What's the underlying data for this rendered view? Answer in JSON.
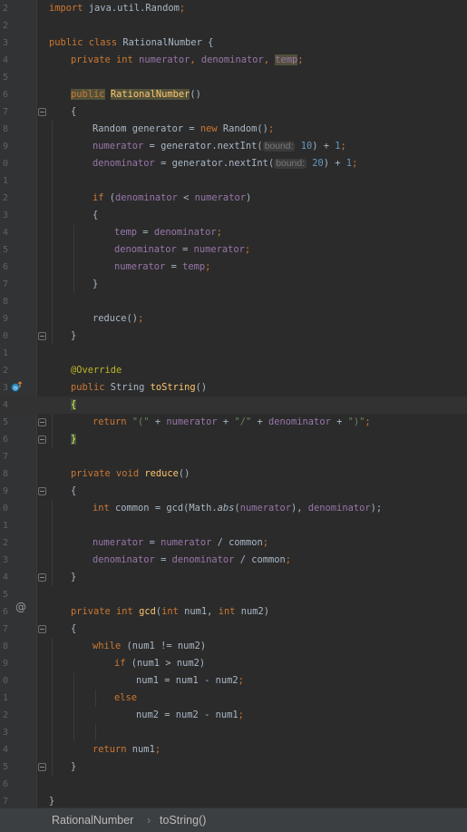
{
  "editor": {
    "lines": [
      {
        "num": "2",
        "indent": 0,
        "tokens": [
          {
            "t": "import ",
            "c": "kw"
          },
          {
            "t": "java.util.Random",
            "c": ""
          },
          {
            "t": ";",
            "c": "kw"
          }
        ]
      },
      {
        "num": "2",
        "indent": 0,
        "tokens": []
      },
      {
        "num": "3",
        "indent": 0,
        "tokens": [
          {
            "t": "public class ",
            "c": "kw"
          },
          {
            "t": "RationalNumber {",
            "c": ""
          }
        ]
      },
      {
        "num": "4",
        "indent": 1,
        "tokens": [
          {
            "t": "private int ",
            "c": "kw"
          },
          {
            "t": "numerator",
            "c": "field"
          },
          {
            "t": ", ",
            "c": "kw"
          },
          {
            "t": "denominator",
            "c": "field"
          },
          {
            "t": ", ",
            "c": "kw"
          },
          {
            "t": "temp",
            "c": "field hl"
          },
          {
            "t": ";",
            "c": "kw"
          }
        ]
      },
      {
        "num": "5",
        "indent": 0,
        "tokens": []
      },
      {
        "num": "6",
        "indent": 1,
        "tokens": [
          {
            "t": "public",
            "c": "kw hl"
          },
          {
            "t": " ",
            "c": ""
          },
          {
            "t": "RationalNumber",
            "c": "method hl"
          },
          {
            "t": "()",
            "c": ""
          }
        ]
      },
      {
        "num": "7",
        "indent": 1,
        "tokens": [
          {
            "t": "{",
            "c": ""
          }
        ]
      },
      {
        "num": "8",
        "indent": 2,
        "tokens": [
          {
            "t": "Random generator = ",
            "c": ""
          },
          {
            "t": "new ",
            "c": "kw"
          },
          {
            "t": "Random()",
            "c": ""
          },
          {
            "t": ";",
            "c": "kw"
          }
        ]
      },
      {
        "num": "9",
        "indent": 2,
        "tokens": [
          {
            "t": "numerator",
            "c": "field"
          },
          {
            "t": " = generator.nextInt(",
            "c": ""
          },
          {
            "t": "bound:",
            "c": "hint"
          },
          {
            "t": " 10",
            "c": "num"
          },
          {
            "t": ") + ",
            "c": ""
          },
          {
            "t": "1",
            "c": "num"
          },
          {
            "t": ";",
            "c": "kw"
          }
        ]
      },
      {
        "num": "0",
        "indent": 2,
        "tokens": [
          {
            "t": "denominator",
            "c": "field"
          },
          {
            "t": " = generator.nextInt(",
            "c": ""
          },
          {
            "t": "bound:",
            "c": "hint"
          },
          {
            "t": " 20",
            "c": "num"
          },
          {
            "t": ") + ",
            "c": ""
          },
          {
            "t": "1",
            "c": "num"
          },
          {
            "t": ";",
            "c": "kw"
          }
        ]
      },
      {
        "num": "1",
        "indent": 0,
        "tokens": []
      },
      {
        "num": "2",
        "indent": 2,
        "tokens": [
          {
            "t": "if ",
            "c": "kw"
          },
          {
            "t": "(",
            "c": ""
          },
          {
            "t": "denominator",
            "c": "field"
          },
          {
            "t": " < ",
            "c": ""
          },
          {
            "t": "numerator",
            "c": "field"
          },
          {
            "t": ")",
            "c": ""
          }
        ]
      },
      {
        "num": "3",
        "indent": 2,
        "tokens": [
          {
            "t": "{",
            "c": ""
          }
        ]
      },
      {
        "num": "4",
        "indent": 3,
        "tokens": [
          {
            "t": "temp",
            "c": "field"
          },
          {
            "t": " = ",
            "c": ""
          },
          {
            "t": "denominator",
            "c": "field"
          },
          {
            "t": ";",
            "c": "kw"
          }
        ]
      },
      {
        "num": "5",
        "indent": 3,
        "tokens": [
          {
            "t": "denominator",
            "c": "field"
          },
          {
            "t": " = ",
            "c": ""
          },
          {
            "t": "numerator",
            "c": "field"
          },
          {
            "t": ";",
            "c": "kw"
          }
        ]
      },
      {
        "num": "6",
        "indent": 3,
        "tokens": [
          {
            "t": "numerator",
            "c": "field"
          },
          {
            "t": " = ",
            "c": ""
          },
          {
            "t": "temp",
            "c": "field"
          },
          {
            "t": ";",
            "c": "kw"
          }
        ]
      },
      {
        "num": "7",
        "indent": 2,
        "tokens": [
          {
            "t": "}",
            "c": ""
          }
        ]
      },
      {
        "num": "8",
        "indent": 0,
        "tokens": []
      },
      {
        "num": "9",
        "indent": 2,
        "tokens": [
          {
            "t": "reduce",
            "c": ""
          },
          {
            "t": "()",
            "c": ""
          },
          {
            "t": ";",
            "c": "kw"
          }
        ]
      },
      {
        "num": "0",
        "indent": 1,
        "tokens": [
          {
            "t": "}",
            "c": ""
          }
        ]
      },
      {
        "num": "1",
        "indent": 0,
        "tokens": []
      },
      {
        "num": "2",
        "indent": 1,
        "tokens": [
          {
            "t": "@Override",
            "c": "ann"
          }
        ]
      },
      {
        "num": "3",
        "indent": 1,
        "tokens": [
          {
            "t": "public ",
            "c": "kw"
          },
          {
            "t": "String ",
            "c": ""
          },
          {
            "t": "toString",
            "c": "method"
          },
          {
            "t": "()",
            "c": ""
          }
        ]
      },
      {
        "num": "4",
        "indent": 1,
        "tokens": [
          {
            "t": "{",
            "c": "brace-hl"
          }
        ]
      },
      {
        "num": "5",
        "indent": 2,
        "tokens": [
          {
            "t": "return ",
            "c": "kw"
          },
          {
            "t": "\"(\"",
            "c": "str"
          },
          {
            "t": " + ",
            "c": ""
          },
          {
            "t": "numerator",
            "c": "field"
          },
          {
            "t": " + ",
            "c": ""
          },
          {
            "t": "\"/\"",
            "c": "str"
          },
          {
            "t": " + ",
            "c": ""
          },
          {
            "t": "denominator",
            "c": "field"
          },
          {
            "t": " + ",
            "c": ""
          },
          {
            "t": "\")\"",
            "c": "str"
          },
          {
            "t": ";",
            "c": "kw"
          }
        ]
      },
      {
        "num": "6",
        "indent": 1,
        "tokens": [
          {
            "t": "}",
            "c": "brace-hl"
          }
        ]
      },
      {
        "num": "7",
        "indent": 0,
        "tokens": []
      },
      {
        "num": "8",
        "indent": 1,
        "tokens": [
          {
            "t": "private void ",
            "c": "kw"
          },
          {
            "t": "reduce",
            "c": "method"
          },
          {
            "t": "()",
            "c": ""
          }
        ]
      },
      {
        "num": "9",
        "indent": 1,
        "tokens": [
          {
            "t": "{",
            "c": ""
          }
        ]
      },
      {
        "num": "0",
        "indent": 2,
        "tokens": [
          {
            "t": "int ",
            "c": "kw"
          },
          {
            "t": "common = gcd(Math.",
            "c": ""
          },
          {
            "t": "abs",
            "c": "italic"
          },
          {
            "t": "(",
            "c": ""
          },
          {
            "t": "numerator",
            "c": "field"
          },
          {
            "t": "), ",
            "c": ""
          },
          {
            "t": "denominator",
            "c": "field"
          },
          {
            "t": ");",
            "c": ""
          }
        ]
      },
      {
        "num": "1",
        "indent": 0,
        "tokens": []
      },
      {
        "num": "2",
        "indent": 2,
        "tokens": [
          {
            "t": "numerator",
            "c": "field"
          },
          {
            "t": " = ",
            "c": ""
          },
          {
            "t": "numerator",
            "c": "field"
          },
          {
            "t": " / common",
            "c": ""
          },
          {
            "t": ";",
            "c": "kw"
          }
        ]
      },
      {
        "num": "3",
        "indent": 2,
        "tokens": [
          {
            "t": "denominator",
            "c": "field"
          },
          {
            "t": " = ",
            "c": ""
          },
          {
            "t": "denominator",
            "c": "field"
          },
          {
            "t": " / common",
            "c": ""
          },
          {
            "t": ";",
            "c": "kw"
          }
        ]
      },
      {
        "num": "4",
        "indent": 1,
        "tokens": [
          {
            "t": "}",
            "c": ""
          }
        ]
      },
      {
        "num": "5",
        "indent": 0,
        "tokens": []
      },
      {
        "num": "6",
        "indent": 1,
        "tokens": [
          {
            "t": "private int ",
            "c": "kw"
          },
          {
            "t": "gcd",
            "c": "method"
          },
          {
            "t": "(",
            "c": ""
          },
          {
            "t": "int ",
            "c": "kw"
          },
          {
            "t": "num1, ",
            "c": ""
          },
          {
            "t": "int ",
            "c": "kw"
          },
          {
            "t": "num2)",
            "c": ""
          }
        ]
      },
      {
        "num": "7",
        "indent": 1,
        "tokens": [
          {
            "t": "{",
            "c": ""
          }
        ]
      },
      {
        "num": "8",
        "indent": 2,
        "tokens": [
          {
            "t": "while ",
            "c": "kw"
          },
          {
            "t": "(num1 != num2)",
            "c": ""
          }
        ]
      },
      {
        "num": "9",
        "indent": 3,
        "tokens": [
          {
            "t": "if ",
            "c": "kw"
          },
          {
            "t": "(num1 > num2)",
            "c": ""
          }
        ]
      },
      {
        "num": "0",
        "indent": 4,
        "tokens": [
          {
            "t": "num1 = num1 - num2",
            "c": ""
          },
          {
            "t": ";",
            "c": "kw"
          }
        ]
      },
      {
        "num": "1",
        "indent": 3,
        "tokens": [
          {
            "t": "else",
            "c": "kw"
          }
        ]
      },
      {
        "num": "2",
        "indent": 4,
        "tokens": [
          {
            "t": "num2 = num2 - num1",
            "c": ""
          },
          {
            "t": ";",
            "c": "kw"
          }
        ]
      },
      {
        "num": "3",
        "indent": 0,
        "tokens": []
      },
      {
        "num": "4",
        "indent": 2,
        "tokens": [
          {
            "t": "return ",
            "c": "kw"
          },
          {
            "t": "num1",
            "c": ""
          },
          {
            "t": ";",
            "c": "kw"
          }
        ]
      },
      {
        "num": "5",
        "indent": 1,
        "tokens": [
          {
            "t": "}",
            "c": ""
          }
        ]
      },
      {
        "num": "6",
        "indent": 0,
        "tokens": []
      },
      {
        "num": "7",
        "indent": 0,
        "tokens": [
          {
            "t": "}",
            "c": ""
          }
        ]
      }
    ]
  },
  "breadcrumb": {
    "class_name": "RationalNumber",
    "separator": "›",
    "method_name": "toString()"
  },
  "gutter_icons": {
    "override": "override-up-arrow-icon",
    "recursive": "@"
  },
  "colors": {
    "background": "#2b2b2b",
    "keyword": "#cc7832",
    "field": "#9876aa",
    "method": "#ffc66d",
    "number": "#6897bb",
    "string": "#6a8759",
    "annotation": "#bbb529"
  }
}
